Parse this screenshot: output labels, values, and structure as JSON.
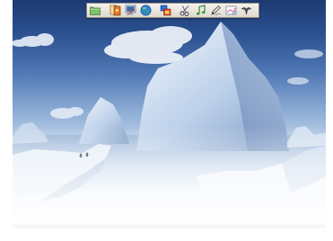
{
  "wallpaper": {
    "name": "iceberg-landscape",
    "colors": {
      "sky_top": "#1d3a72",
      "sky_mid": "#4f77b3",
      "ice": "#dfe9f5",
      "ice_shadow": "#7f9bc4"
    }
  },
  "toolbar": {
    "buttons": [
      {
        "id": "folder",
        "icon": "folder-icon"
      },
      {
        "id": "cards",
        "icon": "card-game-icon"
      },
      {
        "id": "system",
        "icon": "system-tools-icon"
      },
      {
        "id": "internet",
        "icon": "globe-icon"
      },
      {
        "id": "windows",
        "icon": "windows-icon"
      },
      {
        "id": "scissors",
        "icon": "scissors-icon"
      },
      {
        "id": "music",
        "icon": "music-note-icon"
      },
      {
        "id": "pen",
        "icon": "pen-icon"
      },
      {
        "id": "paint",
        "icon": "paint-icon"
      },
      {
        "id": "bird",
        "icon": "bird-icon"
      }
    ]
  }
}
